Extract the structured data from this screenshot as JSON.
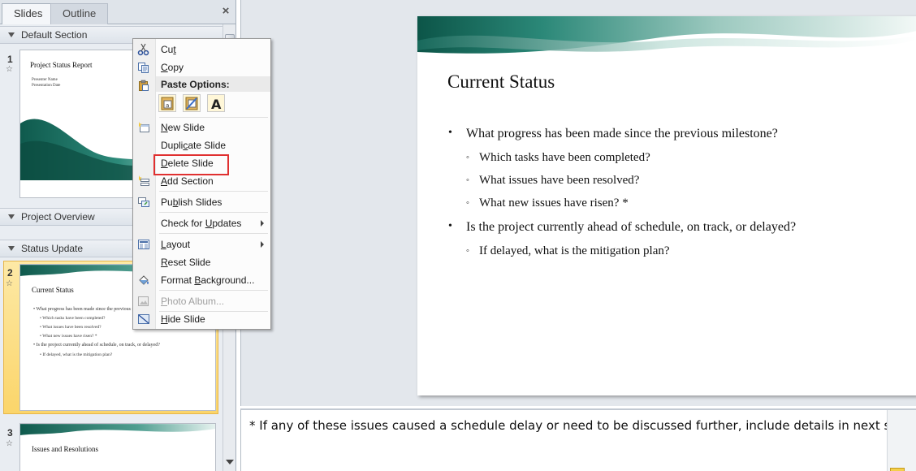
{
  "left_pane": {
    "tabs": [
      {
        "label": "Slides",
        "active": true
      },
      {
        "label": "Outline",
        "active": false
      }
    ],
    "close_label": "×",
    "sections": [
      {
        "name": "Default Section"
      },
      {
        "name": "Project Overview"
      },
      {
        "name": "Status Update"
      }
    ],
    "slides": [
      {
        "number": "1",
        "title": "Project Status Report",
        "lines": [
          "Presenter Name",
          "Presentation Date"
        ]
      },
      {
        "number": "2",
        "title": "Current Status",
        "lines": [
          "What progress has been made since the previous milestone?",
          "Which tasks have been completed?",
          "What issues have been resolved?",
          "What new issues have risen? *",
          "Is the project currently ahead of schedule, on track, or delayed?",
          "If delayed, what is the mitigation plan?"
        ],
        "selected": true
      },
      {
        "number": "3",
        "title": "Issues and Resolutions",
        "lines": []
      }
    ]
  },
  "context_menu": {
    "items": {
      "cut": {
        "pre": "Cu",
        "key": "t",
        "post": ""
      },
      "copy": {
        "pre": "",
        "key": "C",
        "post": "opy"
      },
      "paste_options": "Paste Options:",
      "new_slide": {
        "pre": "",
        "key": "N",
        "post": "ew Slide"
      },
      "duplicate_slide": {
        "pre": "Dupli",
        "key": "c",
        "post": "ate Slide"
      },
      "delete_slide": {
        "pre": "",
        "key": "D",
        "post": "elete Slide"
      },
      "add_section": {
        "pre": "",
        "key": "A",
        "post": "dd Section"
      },
      "publish_slides": {
        "pre": "Pu",
        "key": "b",
        "post": "lish Slides"
      },
      "check_updates": {
        "pre": "Check for ",
        "key": "U",
        "post": "pdates"
      },
      "layout": {
        "pre": "",
        "key": "L",
        "post": "ayout"
      },
      "reset_slide": {
        "pre": "",
        "key": "R",
        "post": "eset Slide"
      },
      "format_background": {
        "pre": "Format ",
        "key": "B",
        "post": "ackground..."
      },
      "photo_album": {
        "pre": "",
        "key": "P",
        "post": "hoto Album..."
      },
      "hide_slide": {
        "pre": "",
        "key": "H",
        "post": "ide Slide"
      }
    }
  },
  "slide": {
    "title": "Current Status",
    "bullets": [
      {
        "level": 1,
        "text": "What progress has been made since the previous milestone?"
      },
      {
        "level": 2,
        "text": "Which tasks have been completed?"
      },
      {
        "level": 2,
        "text": "What issues have been resolved?"
      },
      {
        "level": 2,
        "text": "What new issues have risen? *"
      },
      {
        "level": 1,
        "text": "Is the project currently ahead of schedule, on track, or delayed?"
      },
      {
        "level": 2,
        "text": "If delayed, what is the mitigation plan?"
      }
    ],
    "bullet_l1": "•",
    "bullet_l2": "◦"
  },
  "notes": {
    "text": "* If any of these issues caused a schedule delay or need to be discussed further, include details in next slide."
  },
  "colors": {
    "highlight_box": "#e03030",
    "selected_thumb": "#fbd56a",
    "wave_teal": "#1f6e63"
  }
}
